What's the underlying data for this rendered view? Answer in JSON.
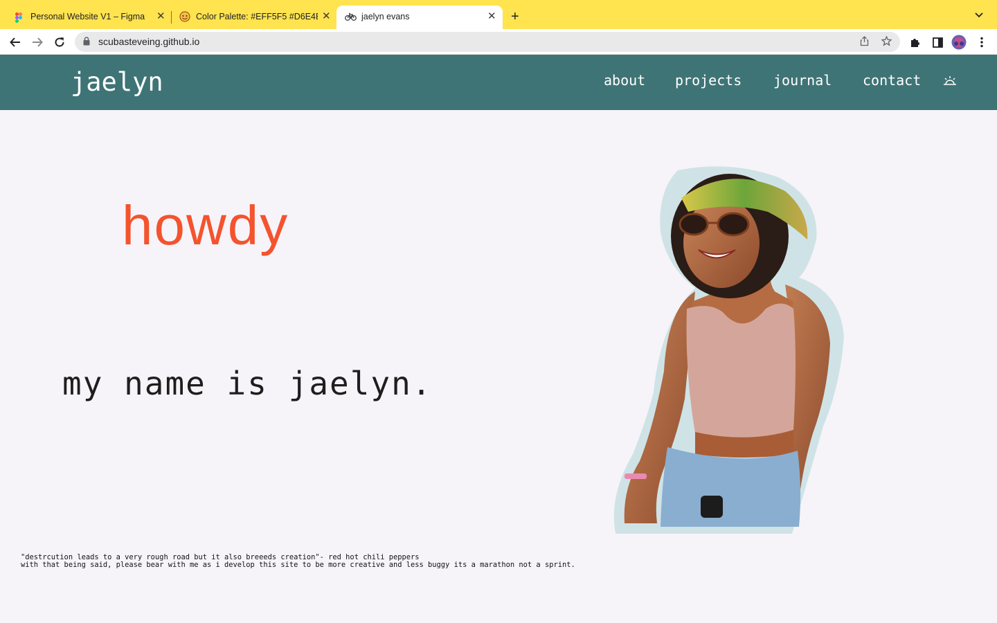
{
  "browser": {
    "tabs": [
      {
        "title": "Personal Website V1 – Figma",
        "icon": "figma-icon",
        "active": false
      },
      {
        "title": "Color Palette: #EFF5F5 #D6E4E",
        "icon": "palette-icon",
        "active": false
      },
      {
        "title": "jaelyn evans",
        "icon": "bicycle-icon",
        "active": true
      }
    ],
    "url": "scubasteveing.github.io",
    "accent": "#FFE34F"
  },
  "site": {
    "logo": "jaelyn",
    "nav": [
      "about",
      "projects",
      "journal",
      "contact"
    ],
    "theme_icon": "sun-icon",
    "colors": {
      "nav_bg": "#3F7476",
      "page_bg": "#F6F4F9",
      "headline": "#F4532E"
    },
    "headline": "howdy",
    "intro": "my name is jaelyn.",
    "quote_line1": "\"destrcution leads to a very rough road but it also breeeds creation\"- red hot chili peppers",
    "quote_line2": "with that being said, please bear with me as i develop this site to be more creative and less buggy its a marathon not a sprint."
  }
}
